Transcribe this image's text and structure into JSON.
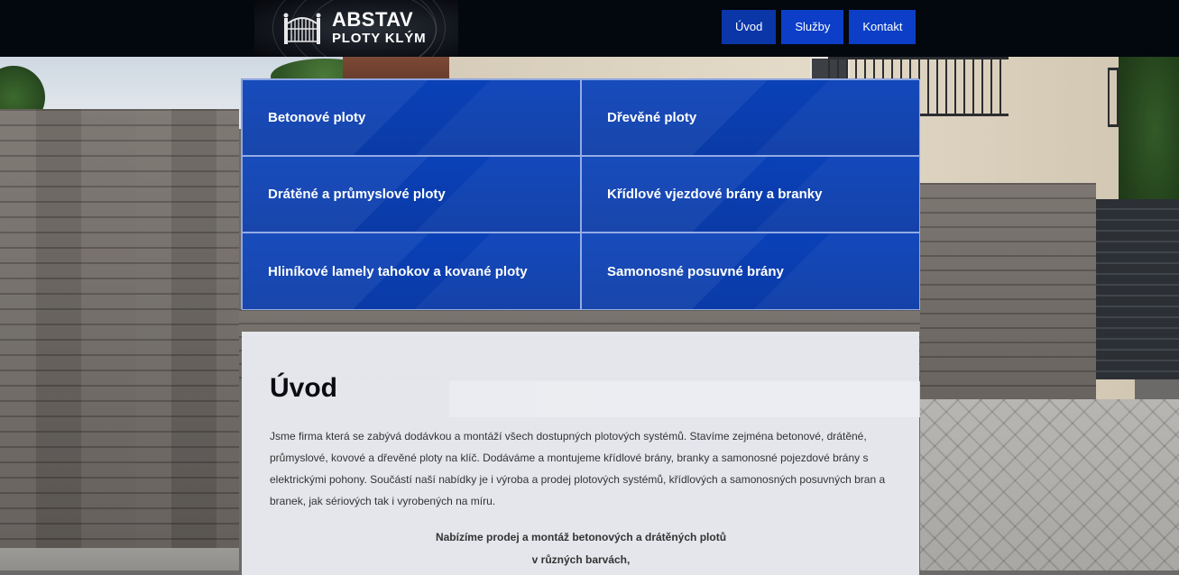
{
  "header": {
    "logo_title": "ABSTAV",
    "logo_subtitle": "PLOTY KLÝM",
    "nav": [
      {
        "label": "Úvod",
        "active": true
      },
      {
        "label": "Služby",
        "active": false
      },
      {
        "label": "Kontakt",
        "active": false
      }
    ]
  },
  "categories": [
    {
      "label": "Betonové ploty"
    },
    {
      "label": "Dřevěné ploty"
    },
    {
      "label": "Drátěné a průmyslové ploty"
    },
    {
      "label": "Křídlové vjezdové brány a branky"
    },
    {
      "label": "Hliníkové lamely tahokov a kované ploty"
    },
    {
      "label": "Samonosné posuvné brány"
    }
  ],
  "content": {
    "heading": "Úvod",
    "intro": "Jsme firma která se zabývá dodávkou a montáží všech dostupných plotových systémů. Stavíme zejména betonové, drátěné, průmyslové, kovové a dřevěné ploty na klíč. Dodáváme a montujeme křídlové brány, branky a samonosné pojezdové brány s elektrickými pohony. Součástí naší nabídky je i výroba a prodej plotových systémů, křídlových a samonosných posuvných  bran a branek, jak sériových tak i vyrobených na míru.",
    "highlight_line1": "Nabízíme prodej a montáž betonových a drátěných plotů",
    "highlight_line2": "v různých barvách,"
  },
  "colors": {
    "accent": "#0c3ec7",
    "header_bg": "#03070e",
    "tile_bg": "#0a3fb3"
  }
}
